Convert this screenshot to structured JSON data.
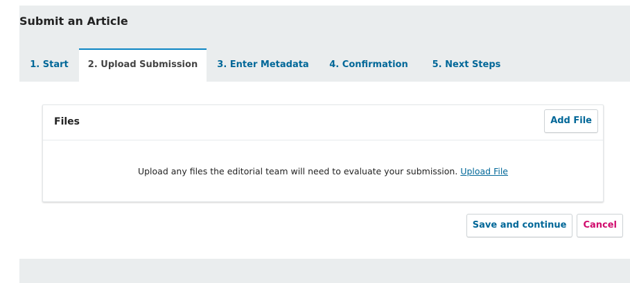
{
  "page": {
    "title": "Submit an Article"
  },
  "tabs": [
    {
      "label": "1. Start",
      "active": false
    },
    {
      "label": "2. Upload Submission",
      "active": true
    },
    {
      "label": "3. Enter Metadata",
      "active": false
    },
    {
      "label": "4. Confirmation",
      "active": false
    },
    {
      "label": "5. Next Steps",
      "active": false
    }
  ],
  "files": {
    "title": "Files",
    "add_button": "Add File",
    "empty_text": "Upload any files the editorial team will need to evaluate your submission.",
    "upload_link": "Upload File"
  },
  "actions": {
    "save_continue": "Save and continue",
    "cancel": "Cancel"
  },
  "colors": {
    "link": "#006798",
    "cancel": "#d00a6c",
    "active_tab_border": "#0a84c2",
    "background": "#eaedee"
  }
}
